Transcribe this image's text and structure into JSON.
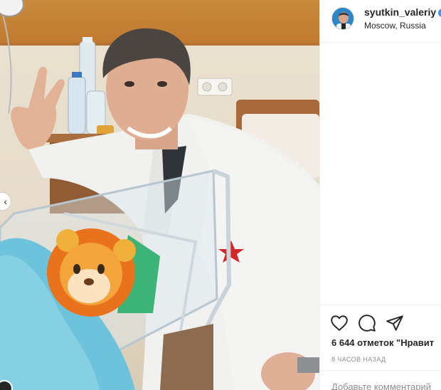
{
  "post": {
    "username": "syutkin_valeriy",
    "location": "Moscow, Russia",
    "likes_text": "6 644 отметок \"Нравит",
    "time_text": "8 ЧАСОВ НАЗАД",
    "comment_placeholder": "Добавьте комментарий",
    "verified_icon": "verified-badge-icon",
    "accent_color": "#3897f0"
  },
  "actions": [
    {
      "icon": "heart-icon"
    },
    {
      "icon": "comment-icon"
    },
    {
      "icon": "share-icon"
    }
  ]
}
